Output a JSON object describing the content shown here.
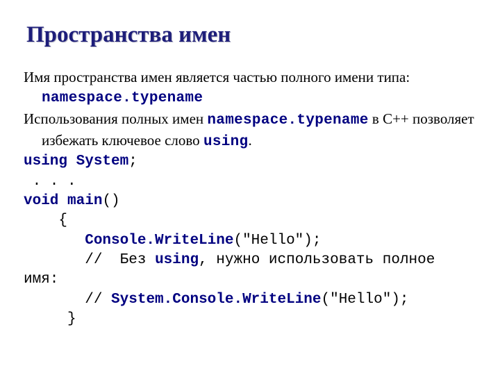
{
  "title": "Пространства имен",
  "para1": {
    "text1": "Имя пространства имен является частью полного имени типа: ",
    "code1": "namespace.typename"
  },
  "para2": {
    "text1": "Использования полных имен ",
    "code1": "namespace.typename",
    "text2": " в С++ позволяет избежать ключевое слово ",
    "code2": "using",
    "text3": "."
  },
  "code": {
    "l1": {
      "kw1": "using",
      "id": "System",
      "sc": ";"
    },
    "l2": " . . .",
    "l3": {
      "kw": "void",
      "id": "main",
      "p": "()"
    },
    "l4": "{",
    "l5": {
      "id": "Console.WriteLine",
      "rest": "(\"Hello\");"
    },
    "l6": {
      "c1": "//",
      "t1": " Без",
      "kw": "using",
      "t2": ", нужно использовать полное"
    },
    "l6b": "имя:",
    "l7": {
      "c": "//",
      "id": "System.Console.WriteLine",
      "rest": "(\"Hello\");"
    },
    "l8": "}"
  }
}
